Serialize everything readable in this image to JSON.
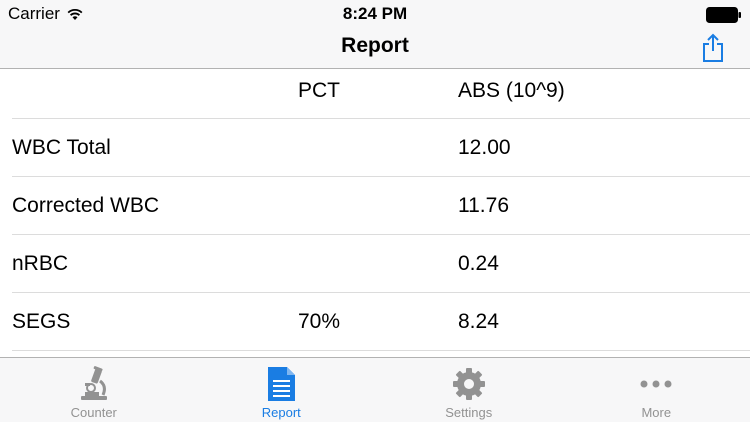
{
  "status_bar": {
    "carrier": "Carrier",
    "time": "8:24 PM"
  },
  "nav": {
    "title": "Report",
    "share_icon": "share-icon"
  },
  "table": {
    "headers": {
      "name": "",
      "pct": "PCT",
      "abs": "ABS (10^9)"
    },
    "rows": [
      {
        "name": "WBC Total",
        "pct": "",
        "abs": "12.00"
      },
      {
        "name": "Corrected WBC",
        "pct": "",
        "abs": "11.76"
      },
      {
        "name": "nRBC",
        "pct": "",
        "abs": "0.24"
      },
      {
        "name": "SEGS",
        "pct": "70%",
        "abs": "8.24"
      }
    ]
  },
  "tabs": [
    {
      "label": "Counter",
      "icon": "microscope-icon",
      "active": false
    },
    {
      "label": "Report",
      "icon": "document-icon",
      "active": true
    },
    {
      "label": "Settings",
      "icon": "gear-icon",
      "active": false
    },
    {
      "label": "More",
      "icon": "more-icon",
      "active": false
    }
  ],
  "colors": {
    "accent": "#1a7de3",
    "inactive": "#929292",
    "bar_background": "#f7f7f8"
  }
}
